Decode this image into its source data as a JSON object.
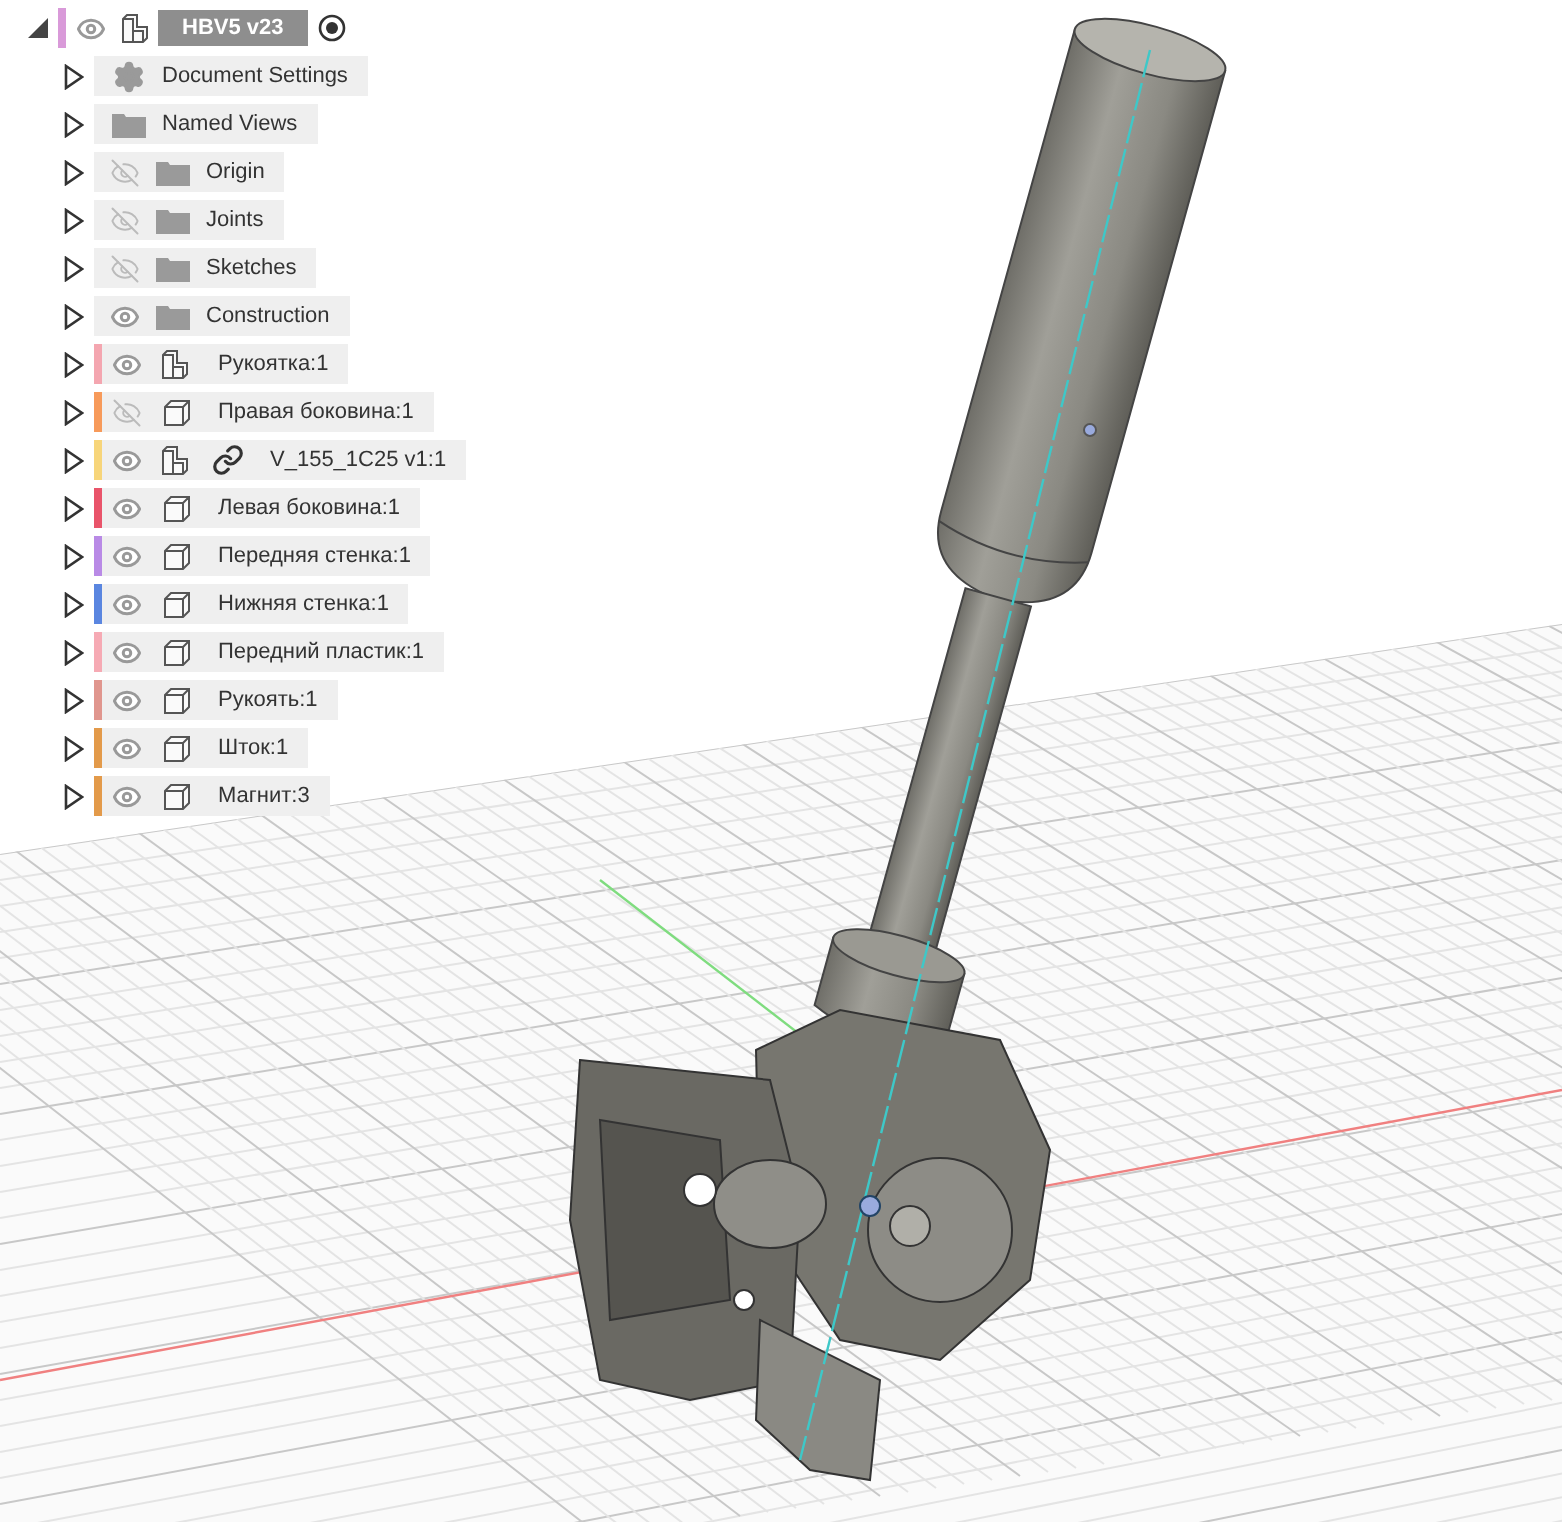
{
  "browser": {
    "root": {
      "name": "HBV5 v23",
      "expanded": true,
      "visible": true,
      "color": "#d99ad9",
      "active": true
    },
    "items": [
      {
        "kind": "settings",
        "name": "Document Settings",
        "expanded": false
      },
      {
        "kind": "folder",
        "name": "Named Views",
        "expanded": false
      },
      {
        "kind": "folder",
        "name": "Origin",
        "visible": false,
        "expanded": false
      },
      {
        "kind": "folder",
        "name": "Joints",
        "visible": false,
        "expanded": false
      },
      {
        "kind": "folder",
        "name": "Sketches",
        "visible": false,
        "expanded": false
      },
      {
        "kind": "folder",
        "name": "Construction",
        "visible": true,
        "expanded": false
      },
      {
        "kind": "assembly",
        "name": "Рукоятка:1",
        "visible": true,
        "expanded": false,
        "color": "#f4a6b0"
      },
      {
        "kind": "body",
        "name": "Правая боковина:1",
        "visible": false,
        "expanded": false,
        "color": "#f79a5a"
      },
      {
        "kind": "assembly",
        "name": "V_155_1C25 v1:1",
        "visible": true,
        "expanded": false,
        "color": "#f7d57a",
        "linked": true
      },
      {
        "kind": "body",
        "name": "Левая боковина:1",
        "visible": true,
        "expanded": false,
        "color": "#e9546a"
      },
      {
        "kind": "body",
        "name": "Передняя стенка:1",
        "visible": true,
        "expanded": false,
        "color": "#b98ae6"
      },
      {
        "kind": "body",
        "name": "Нижняя стенка:1",
        "visible": true,
        "expanded": false,
        "color": "#5a86e0"
      },
      {
        "kind": "body",
        "name": "Передний пластик:1",
        "visible": true,
        "expanded": false,
        "color": "#f6aab4"
      },
      {
        "kind": "body",
        "name": "Рукоять:1",
        "visible": true,
        "expanded": false,
        "color": "#e0968e"
      },
      {
        "kind": "body",
        "name": "Шток:1",
        "visible": true,
        "expanded": false,
        "color": "#e39a4a"
      },
      {
        "kind": "body",
        "name": "Магнит:3",
        "visible": true,
        "expanded": false,
        "color": "#e39a4a"
      }
    ]
  }
}
